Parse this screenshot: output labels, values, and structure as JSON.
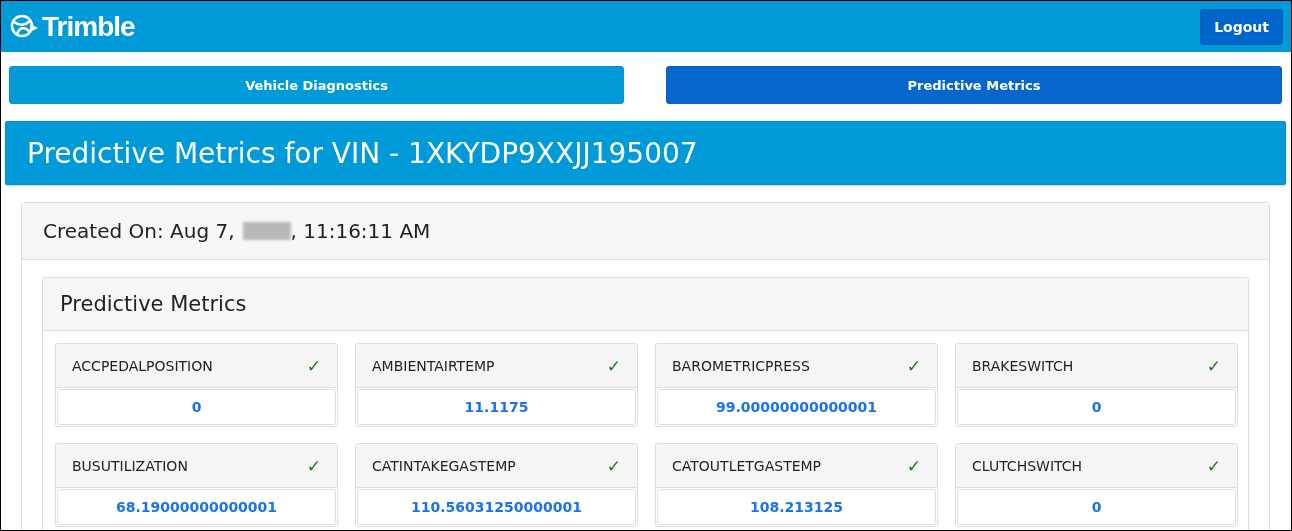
{
  "header": {
    "brand": "Trimble",
    "logout": "Logout"
  },
  "tabs": [
    {
      "label": "Vehicle Diagnostics",
      "selected": false
    },
    {
      "label": "Predictive Metrics",
      "selected": true
    }
  ],
  "title": "Predictive Metrics for VIN - 1XKYDP9XXJJ195007",
  "created": {
    "before": "Created On: Aug 7,",
    "after": ", 11:16:11 AM",
    "year_redacted": true
  },
  "section_title": "Predictive Metrics",
  "metrics": [
    {
      "name": "ACCPEDALPOSITION",
      "check": "✓",
      "value": "0"
    },
    {
      "name": "AMBIENTAIRTEMP",
      "check": "✓",
      "value": "11.1175"
    },
    {
      "name": "BAROMETRICPRESS",
      "check": "✓",
      "value": "99.00000000000001"
    },
    {
      "name": "BRAKESWITCH",
      "check": "✓",
      "value": "0"
    },
    {
      "name": "BUSUTILIZATION",
      "check": "✓",
      "value": "68.19000000000001"
    },
    {
      "name": "CATINTAKEGASTEMP",
      "check": "✓",
      "value": "110.56031250000001"
    },
    {
      "name": "CATOUTLETGASTEMP",
      "check": "✓",
      "value": "108.213125"
    },
    {
      "name": "CLUTCHSWITCH",
      "check": "✓",
      "value": "0"
    }
  ]
}
